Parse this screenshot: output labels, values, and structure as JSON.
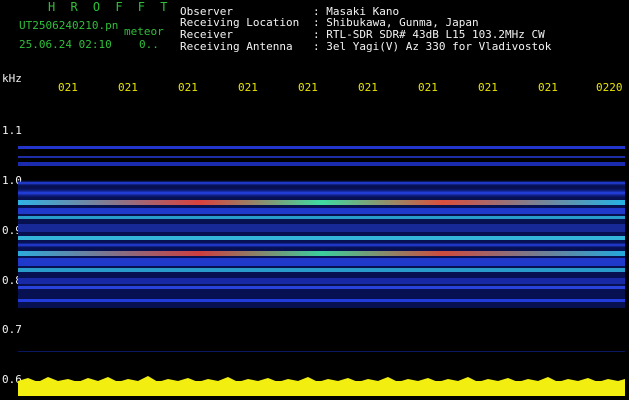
{
  "header": {
    "title": "H R O F F T",
    "filename": "UT2506240210.pn",
    "filename_suffix": "meteor",
    "datetime": "25.06.24 02:10",
    "datetime_suffix": "0..",
    "fields": [
      {
        "label": "Observer",
        "value": ": Masaki Kano"
      },
      {
        "label": "Receiving Location",
        "value": ": Shibukawa, Gunma, Japan"
      },
      {
        "label": "Receiver",
        "value": ": RTL-SDR SDR# 43dB L15 103.2MHz CW"
      },
      {
        "label": "Receiving Antenna",
        "value": ": 3el Yagi(V) Az 330 for Vladivostok"
      }
    ]
  },
  "axes": {
    "y_unit": "kHz",
    "y_labels": [
      "1.1",
      "1.0",
      "0.9",
      "0.8",
      "0.7",
      "0.6"
    ],
    "x_ticks": [
      "021",
      "021",
      "021",
      "021",
      "021",
      "021",
      "021",
      "021",
      "021",
      "0220"
    ]
  },
  "colors": {
    "background": "#000000",
    "text_green": "#2fbf3a",
    "text_white": "#f2f2f2",
    "tick_yellow": "#e8e400",
    "spectrum_blue": "#1a2fbf"
  }
}
